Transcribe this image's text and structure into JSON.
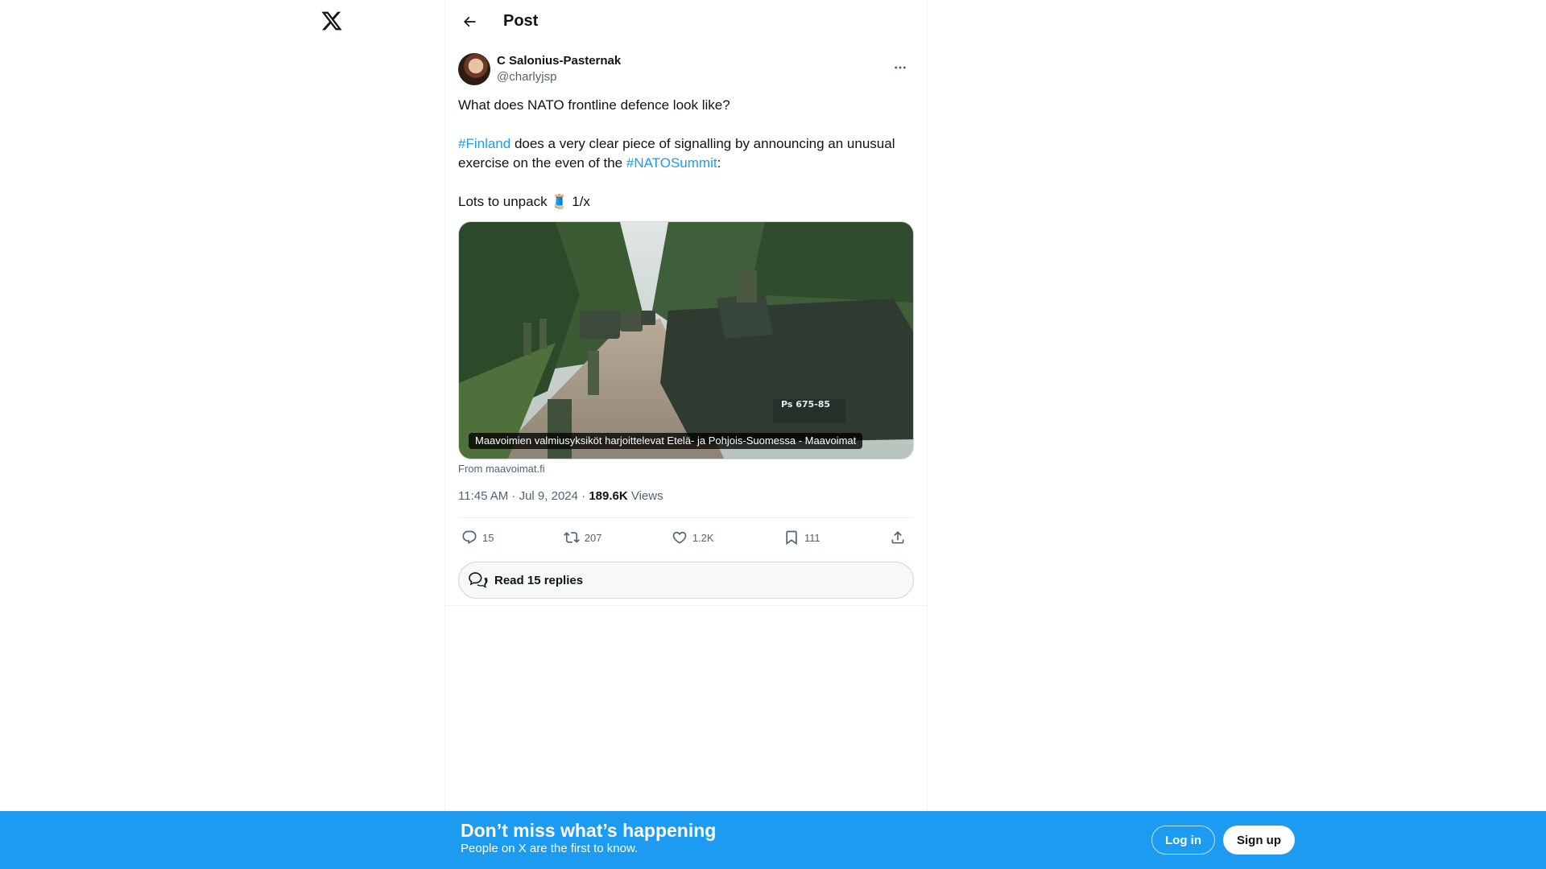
{
  "header": {
    "title": "Post"
  },
  "post": {
    "author": {
      "name": "C Salonius-Pasternak",
      "handle": "@charlyjsp"
    },
    "text": {
      "line1": "What does NATO frontline defence look like?",
      "hashtag_finland": "#Finland",
      "mid_text": " does a very clear piece of signalling by announcing an unusual exercise on the even of the ",
      "hashtag_nato": "#NATOSummit",
      "colon": ":",
      "line3": "Lots to unpack 🧵 1/x"
    },
    "card": {
      "caption": "Maavoimien valmiusyksiköt harjoittelevat Etelä- ja Pohjois-Suomessa - Maavoimat",
      "source": "From maavoimat.fi",
      "vehicle_plate": "Ps 675-85"
    },
    "meta": {
      "time": "11:45 AM · Jul 9, 2024 · ",
      "views_count": "189.6K",
      "views_label": " Views"
    },
    "actions": {
      "replies": "15",
      "reposts": "207",
      "likes": "1.2K",
      "bookmarks": "111"
    },
    "read_replies": "Read 15 replies"
  },
  "banner": {
    "title": "Don’t miss what’s happening",
    "subtitle": "People on X are the first to know.",
    "login": "Log in",
    "signup": "Sign up"
  },
  "colors": {
    "accent": "#1d9bf0",
    "text": "#0f1419",
    "muted": "#536471"
  }
}
